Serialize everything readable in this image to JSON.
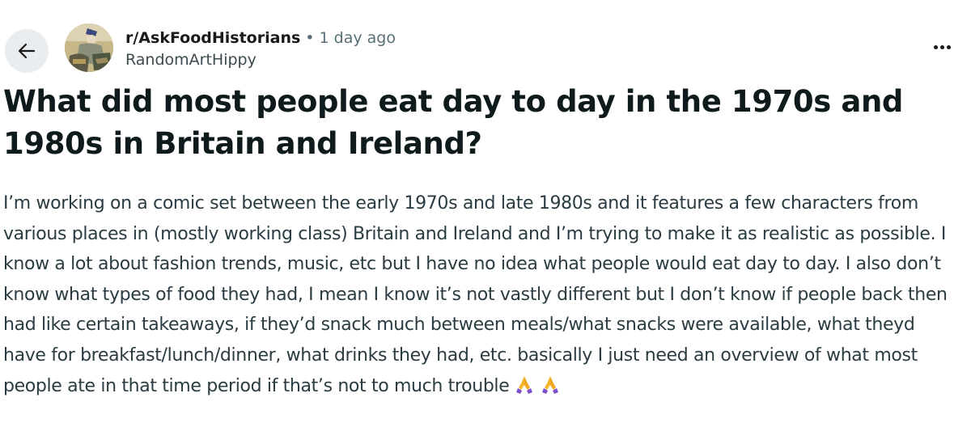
{
  "post": {
    "subreddit": "r/AskFoodHistorians",
    "separator": "•",
    "time_ago": "1 day ago",
    "author": "RandomArtHippy",
    "title": "What did most people eat day to day in the 1970s and 1980s in Britain and Ireland?",
    "body": "I’m working on a comic set between the early 1970s and late 1980s and it features a few characters from various places in (mostly working class) Britain and Ireland and I’m trying to make it as realistic as possible. I know a lot about fashion trends, music, etc but I have no idea what people would eat day to day. I also don’t know what types of food they had, I mean I know it’s not vastly different but I don’t know if people back then had like certain takeaways, if they’d snack much between meals/what snacks were available, what theyd have for breakfast/lunch/dinner, what drinks they had, etc. basically I just need an overview of what most people ate in that time period if that’s not to much trouble",
    "emojis": [
      "folded-hands-icon",
      "folded-hands-icon"
    ]
  },
  "icons": {
    "back": "arrow-left-icon",
    "more": "more-horizontal-icon"
  },
  "colors": {
    "back_button_bg": "#eaedef",
    "meta_gray": "#576f76",
    "title": "#0f1a1c",
    "body": "#2a3c42",
    "emoji": "#f7b52b",
    "emoji_cuff": "#7a4fc7"
  }
}
